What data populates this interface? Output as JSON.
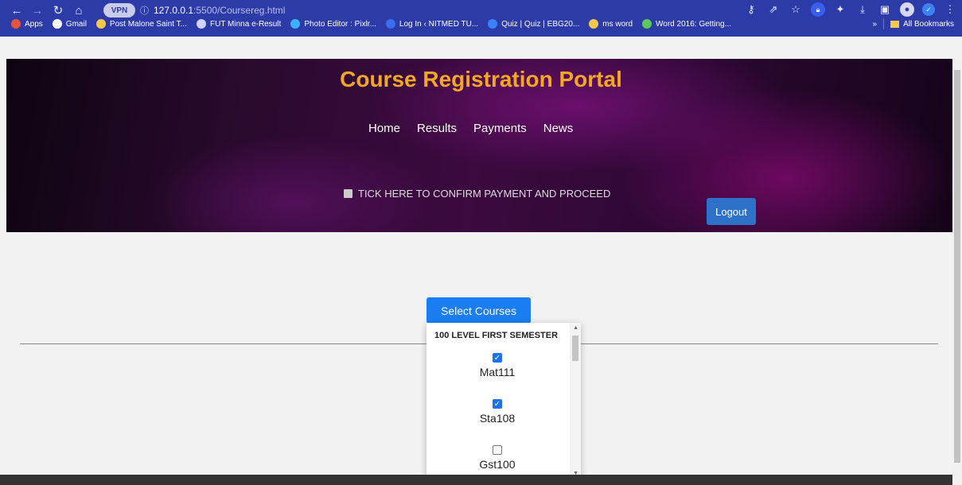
{
  "browser": {
    "vpn_label": "VPN",
    "url_host": "127.0.0.1",
    "url_path": ":5500/Coursereg.html",
    "bookmarks": [
      {
        "label": "Apps",
        "color": "#e8543a"
      },
      {
        "label": "Gmail",
        "color": "#ffffff"
      },
      {
        "label": "Post Malone Saint T...",
        "color": "#f2c94c"
      },
      {
        "label": "FUT Minna e-Result",
        "color": "#cfd4ff"
      },
      {
        "label": "Photo Editor : Pixlr...",
        "color": "#3ab0ff"
      },
      {
        "label": "Log In ‹ NITMED TU...",
        "color": "#3a6df0"
      },
      {
        "label": "Quiz | Quiz | EBG20...",
        "color": "#3b82f6"
      },
      {
        "label": "ms word",
        "color": "#f2c94c"
      },
      {
        "label": "Word 2016: Getting...",
        "color": "#5cc85c"
      }
    ],
    "more_bookmarks": "»",
    "all_bookmarks": "All Bookmarks"
  },
  "page": {
    "title": "Course Registration Portal",
    "nav": [
      "Home",
      "Results",
      "Payments",
      "News"
    ],
    "confirm_label": "TICK HERE TO CONFIRM PAYMENT AND PROCEED",
    "logout_label": "Logout",
    "select_courses_label": "Select Courses"
  },
  "dropdown": {
    "heading": "100 LEVEL FIRST SEMESTER",
    "courses": [
      {
        "label": "Mat111",
        "checked": true
      },
      {
        "label": "Sta108",
        "checked": true
      },
      {
        "label": "Gst100",
        "checked": false
      }
    ]
  },
  "colors": {
    "title": "#f5a623",
    "primary_button": "#1a7ef2",
    "logout_button": "#2d72c8",
    "browser_chrome": "#2c3ba8"
  }
}
